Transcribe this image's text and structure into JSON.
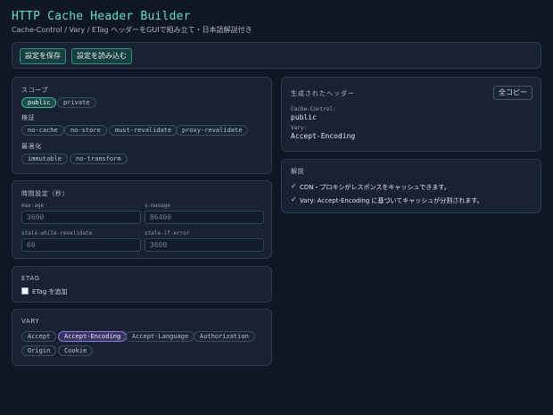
{
  "app": {
    "title": "HTTP Cache Header Builder",
    "subtitle": "Cache-Control / Vary / ETag ヘッダーをGUIで組み立て・日本語解説付き"
  },
  "toolbar": {
    "save_label": "設定を保存",
    "load_label": "設定を読み込む"
  },
  "scope": {
    "heading": "スコープ",
    "options": [
      "public",
      "private"
    ],
    "selected": "public",
    "validation_heading": "検証",
    "validation_options": [
      "no-cache",
      "no-store",
      "must-revalidate",
      "proxy-revalidate"
    ],
    "optimization_heading": "最適化",
    "optimization_options": [
      "immutable",
      "no-transform"
    ]
  },
  "time": {
    "heading": "時間設定（秒）",
    "fields": [
      {
        "label": "max-age",
        "placeholder": "3600"
      },
      {
        "label": "s-maxage",
        "placeholder": "86400"
      },
      {
        "label": "stale-while-revalidate",
        "placeholder": "60"
      },
      {
        "label": "stale-if-error",
        "placeholder": "3600"
      }
    ]
  },
  "etag": {
    "heading": "ETAG",
    "checkbox_label": "ETag を追加",
    "checked": false
  },
  "vary": {
    "heading": "VARY",
    "options": [
      "Accept",
      "Accept-Encoding",
      "Accept-Language",
      "Authorization",
      "Origin",
      "Cookie"
    ],
    "selected": "Accept-Encoding"
  },
  "output": {
    "heading": "生成されたヘッダー",
    "copy_label": "全コピー",
    "lines": [
      {
        "name": "Cache-Control:",
        "value": "public"
      },
      {
        "name": "Vary:",
        "value": "Accept-Encoding"
      }
    ]
  },
  "explanation": {
    "heading": "解説",
    "items": [
      "CDN・プロキシがレスポンスをキャッシュできます。",
      "Vary: Accept-Encoding に基づいてキャッシュが分割されます。"
    ]
  },
  "colors": {
    "accent": "#5ee0c8",
    "vary_active": "#8a7de0",
    "background": "#0f1624"
  },
  "icons": {
    "check": "check-icon"
  }
}
